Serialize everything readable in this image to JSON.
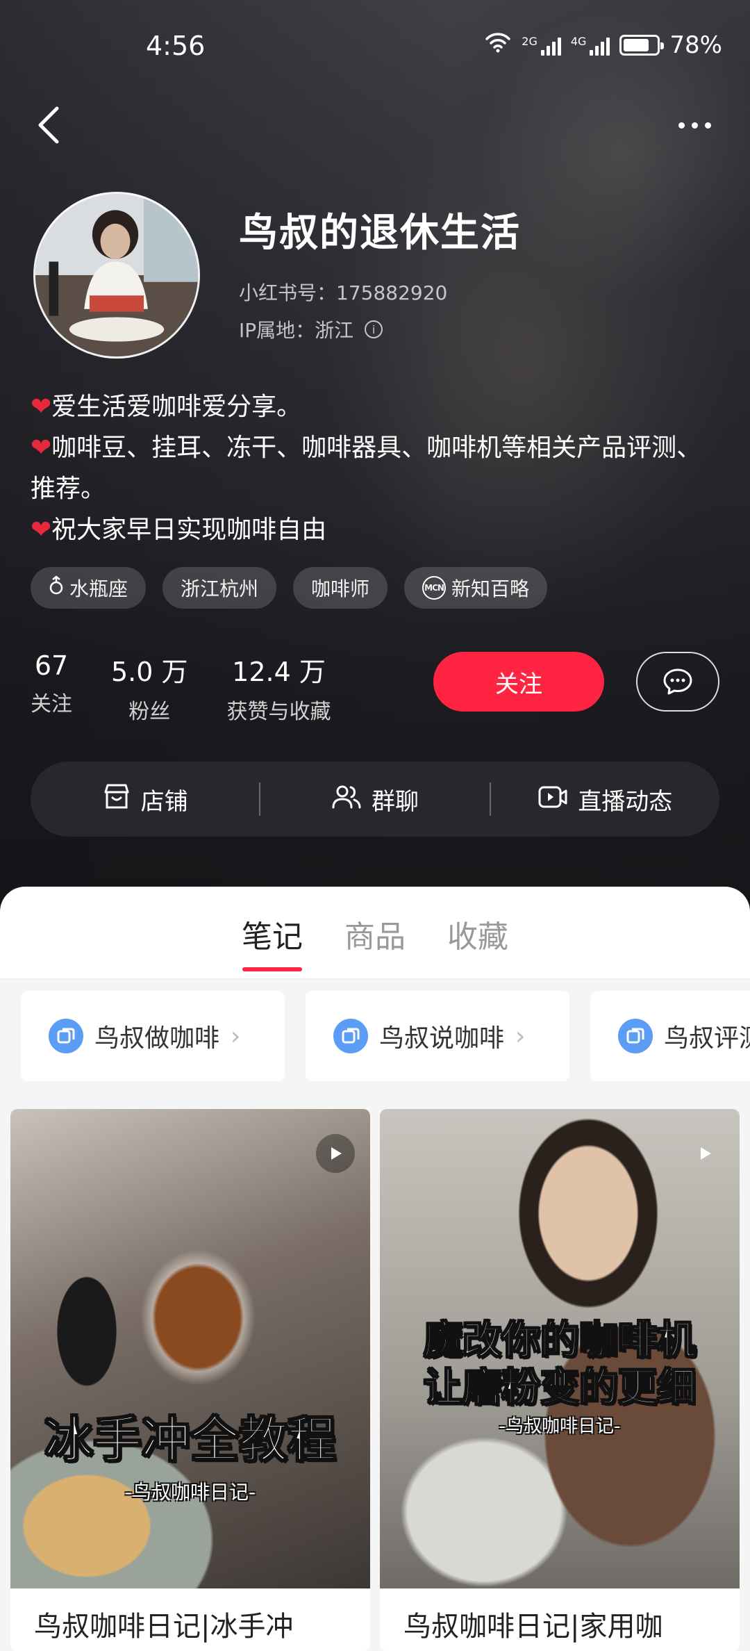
{
  "status": {
    "time": "4:56",
    "battery": "78%",
    "battery_level": 0.78,
    "sig1_label": "2G",
    "sig2_label": "4G"
  },
  "profile": {
    "name": "鸟叔的退休生活",
    "id_text": "小红书号：175882920",
    "ip_text": "IP属地：浙江",
    "bio": [
      "❤️爱生活爱咖啡爱分享。",
      "❤️咖啡豆、挂耳、冻干、咖啡器具、咖啡机等相关产品评测、推荐。",
      "❤️祝大家早日实现咖啡自由"
    ],
    "tags": [
      {
        "label": "水瓶座",
        "icon": "aquarius-icon"
      },
      {
        "label": "浙江杭州",
        "icon": ""
      },
      {
        "label": "咖啡师",
        "icon": ""
      },
      {
        "label": "新知百略",
        "icon": "mcn-icon"
      }
    ]
  },
  "stats": [
    {
      "num": "67",
      "label": "关注"
    },
    {
      "num": "5.0 万",
      "label": "粉丝"
    },
    {
      "num": "12.4 万",
      "label": "获赞与收藏"
    }
  ],
  "buttons": {
    "follow": "关注"
  },
  "actions": [
    {
      "label": "店铺",
      "icon": "store-icon"
    },
    {
      "label": "群聊",
      "icon": "group-icon"
    },
    {
      "label": "直播动态",
      "icon": "live-icon"
    }
  ],
  "tabs": [
    {
      "label": "笔记",
      "active": true
    },
    {
      "label": "商品",
      "active": false
    },
    {
      "label": "收藏",
      "active": false
    }
  ],
  "albums": [
    {
      "label": "鸟叔做咖啡"
    },
    {
      "label": "鸟叔说咖啡"
    },
    {
      "label": "鸟叔评测"
    }
  ],
  "notes": [
    {
      "cover_title": "冰手冲全教程",
      "cover_sub": "-鸟叔咖啡日记-",
      "title": "鸟叔咖啡日记|冰手冲"
    },
    {
      "cover_title": "魔改你的咖啡机\n让磨粉变的更细",
      "cover_sub": "-鸟叔咖啡日记-",
      "title": "鸟叔咖啡日记|家用咖"
    }
  ],
  "colors": {
    "accent": "#ff2442",
    "heart": "#e8283c",
    "album_icon": "#5b9cf5"
  }
}
